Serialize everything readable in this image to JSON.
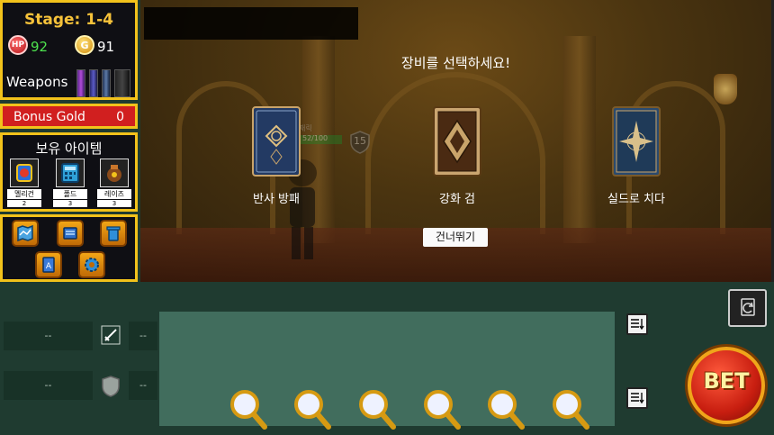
{
  "hud": {
    "stage": "Stage: 1-4",
    "hp_icon_label": "HP",
    "hp": "92",
    "gold_icon_label": "G",
    "gold": "91",
    "weapons_label": "Weapons"
  },
  "bonus": {
    "label": "Bonus Gold",
    "value": "0"
  },
  "inventory": {
    "title": "보유 아이템",
    "items": [
      {
        "name": "멜리건",
        "count": "2",
        "icon": "potion-icon"
      },
      {
        "name": "폴드",
        "count": "3",
        "icon": "calculator-icon"
      },
      {
        "name": "레이즈",
        "count": "3",
        "icon": "bag-icon"
      }
    ]
  },
  "menu": [
    "map-icon",
    "book-icon",
    "trash-icon",
    "card-deck-icon",
    "settings-icon"
  ],
  "scene": {
    "prompt": "장비를 선택하세요!",
    "cards": [
      {
        "name": "반사 방패",
        "style": "blue"
      },
      {
        "name": "강화 검",
        "style": "tan"
      },
      {
        "name": "실드로 치다",
        "style": "blue-compass"
      }
    ],
    "skip_label": "건너뛰기",
    "enemy_name": "재릭",
    "enemy_hp": "52/100",
    "enemy_level": "15"
  },
  "board": {
    "left_slot_1": "--",
    "left_slot_2": "--",
    "right_slot_1": "--",
    "right_slot_2": "--",
    "bet_label": "BET"
  },
  "colors": {
    "accent_gold": "#f2c21b",
    "bonus_red": "#d11f1f",
    "board_green": "#1f3b30",
    "card_area": "#416d5d"
  }
}
